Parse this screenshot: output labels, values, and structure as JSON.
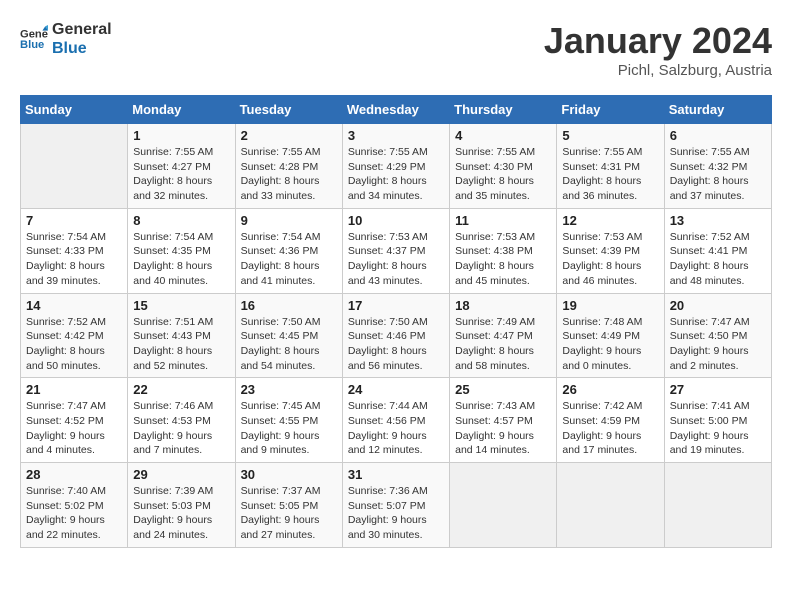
{
  "header": {
    "logo_line1": "General",
    "logo_line2": "Blue",
    "title": "January 2024",
    "subtitle": "Pichl, Salzburg, Austria"
  },
  "columns": [
    "Sunday",
    "Monday",
    "Tuesday",
    "Wednesday",
    "Thursday",
    "Friday",
    "Saturday"
  ],
  "weeks": [
    [
      {
        "day": "",
        "sunrise": "",
        "sunset": "",
        "daylight": ""
      },
      {
        "day": "1",
        "sunrise": "7:55 AM",
        "sunset": "4:27 PM",
        "daylight": "8 hours and 32 minutes."
      },
      {
        "day": "2",
        "sunrise": "7:55 AM",
        "sunset": "4:28 PM",
        "daylight": "8 hours and 33 minutes."
      },
      {
        "day": "3",
        "sunrise": "7:55 AM",
        "sunset": "4:29 PM",
        "daylight": "8 hours and 34 minutes."
      },
      {
        "day": "4",
        "sunrise": "7:55 AM",
        "sunset": "4:30 PM",
        "daylight": "8 hours and 35 minutes."
      },
      {
        "day": "5",
        "sunrise": "7:55 AM",
        "sunset": "4:31 PM",
        "daylight": "8 hours and 36 minutes."
      },
      {
        "day": "6",
        "sunrise": "7:55 AM",
        "sunset": "4:32 PM",
        "daylight": "8 hours and 37 minutes."
      }
    ],
    [
      {
        "day": "7",
        "sunrise": "7:54 AM",
        "sunset": "4:33 PM",
        "daylight": "8 hours and 39 minutes."
      },
      {
        "day": "8",
        "sunrise": "7:54 AM",
        "sunset": "4:35 PM",
        "daylight": "8 hours and 40 minutes."
      },
      {
        "day": "9",
        "sunrise": "7:54 AM",
        "sunset": "4:36 PM",
        "daylight": "8 hours and 41 minutes."
      },
      {
        "day": "10",
        "sunrise": "7:53 AM",
        "sunset": "4:37 PM",
        "daylight": "8 hours and 43 minutes."
      },
      {
        "day": "11",
        "sunrise": "7:53 AM",
        "sunset": "4:38 PM",
        "daylight": "8 hours and 45 minutes."
      },
      {
        "day": "12",
        "sunrise": "7:53 AM",
        "sunset": "4:39 PM",
        "daylight": "8 hours and 46 minutes."
      },
      {
        "day": "13",
        "sunrise": "7:52 AM",
        "sunset": "4:41 PM",
        "daylight": "8 hours and 48 minutes."
      }
    ],
    [
      {
        "day": "14",
        "sunrise": "7:52 AM",
        "sunset": "4:42 PM",
        "daylight": "8 hours and 50 minutes."
      },
      {
        "day": "15",
        "sunrise": "7:51 AM",
        "sunset": "4:43 PM",
        "daylight": "8 hours and 52 minutes."
      },
      {
        "day": "16",
        "sunrise": "7:50 AM",
        "sunset": "4:45 PM",
        "daylight": "8 hours and 54 minutes."
      },
      {
        "day": "17",
        "sunrise": "7:50 AM",
        "sunset": "4:46 PM",
        "daylight": "8 hours and 56 minutes."
      },
      {
        "day": "18",
        "sunrise": "7:49 AM",
        "sunset": "4:47 PM",
        "daylight": "8 hours and 58 minutes."
      },
      {
        "day": "19",
        "sunrise": "7:48 AM",
        "sunset": "4:49 PM",
        "daylight": "9 hours and 0 minutes."
      },
      {
        "day": "20",
        "sunrise": "7:47 AM",
        "sunset": "4:50 PM",
        "daylight": "9 hours and 2 minutes."
      }
    ],
    [
      {
        "day": "21",
        "sunrise": "7:47 AM",
        "sunset": "4:52 PM",
        "daylight": "9 hours and 4 minutes."
      },
      {
        "day": "22",
        "sunrise": "7:46 AM",
        "sunset": "4:53 PM",
        "daylight": "9 hours and 7 minutes."
      },
      {
        "day": "23",
        "sunrise": "7:45 AM",
        "sunset": "4:55 PM",
        "daylight": "9 hours and 9 minutes."
      },
      {
        "day": "24",
        "sunrise": "7:44 AM",
        "sunset": "4:56 PM",
        "daylight": "9 hours and 12 minutes."
      },
      {
        "day": "25",
        "sunrise": "7:43 AM",
        "sunset": "4:57 PM",
        "daylight": "9 hours and 14 minutes."
      },
      {
        "day": "26",
        "sunrise": "7:42 AM",
        "sunset": "4:59 PM",
        "daylight": "9 hours and 17 minutes."
      },
      {
        "day": "27",
        "sunrise": "7:41 AM",
        "sunset": "5:00 PM",
        "daylight": "9 hours and 19 minutes."
      }
    ],
    [
      {
        "day": "28",
        "sunrise": "7:40 AM",
        "sunset": "5:02 PM",
        "daylight": "9 hours and 22 minutes."
      },
      {
        "day": "29",
        "sunrise": "7:39 AM",
        "sunset": "5:03 PM",
        "daylight": "9 hours and 24 minutes."
      },
      {
        "day": "30",
        "sunrise": "7:37 AM",
        "sunset": "5:05 PM",
        "daylight": "9 hours and 27 minutes."
      },
      {
        "day": "31",
        "sunrise": "7:36 AM",
        "sunset": "5:07 PM",
        "daylight": "9 hours and 30 minutes."
      },
      {
        "day": "",
        "sunrise": "",
        "sunset": "",
        "daylight": ""
      },
      {
        "day": "",
        "sunrise": "",
        "sunset": "",
        "daylight": ""
      },
      {
        "day": "",
        "sunrise": "",
        "sunset": "",
        "daylight": ""
      }
    ]
  ],
  "labels": {
    "sunrise_prefix": "Sunrise: ",
    "sunset_prefix": "Sunset: ",
    "daylight_prefix": "Daylight: "
  }
}
